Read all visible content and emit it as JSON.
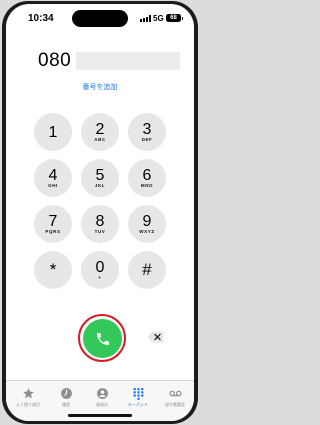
{
  "status": {
    "time": "10:34",
    "network": "5G",
    "battery": "68"
  },
  "dialer": {
    "number_prefix": "080",
    "add_number_label": "番号を追加"
  },
  "keypad": [
    {
      "digit": "1",
      "letters": ""
    },
    {
      "digit": "2",
      "letters": "ABC"
    },
    {
      "digit": "3",
      "letters": "DEF"
    },
    {
      "digit": "4",
      "letters": "GHI"
    },
    {
      "digit": "5",
      "letters": "JKL"
    },
    {
      "digit": "6",
      "letters": "MNO"
    },
    {
      "digit": "7",
      "letters": "PQRS"
    },
    {
      "digit": "8",
      "letters": "TUV"
    },
    {
      "digit": "9",
      "letters": "WXYZ"
    },
    {
      "digit": "*",
      "letters": ""
    },
    {
      "digit": "0",
      "letters": "+"
    },
    {
      "digit": "#",
      "letters": ""
    }
  ],
  "actions": {
    "call_icon": "phone-icon",
    "delete_icon": "delete-backspace-icon"
  },
  "tabbar": {
    "items": [
      {
        "label": "よく使う項目",
        "icon": "star-icon"
      },
      {
        "label": "履歴",
        "icon": "clock-icon"
      },
      {
        "label": "連絡先",
        "icon": "person-icon"
      },
      {
        "label": "キーパッド",
        "icon": "keypad-icon"
      },
      {
        "label": "留守番電話",
        "icon": "voicemail-icon"
      }
    ],
    "active_index": 3
  },
  "colors": {
    "accent": "#1a7bf0",
    "call": "#34c759",
    "highlight_ring": "#d41f26",
    "key_bg": "#e7e7e9"
  }
}
